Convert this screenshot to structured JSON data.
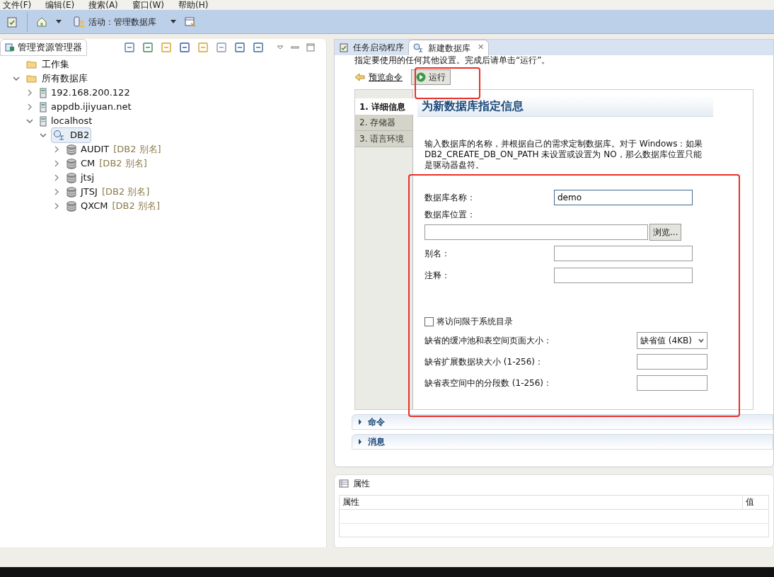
{
  "menu": [
    "文件(F)",
    "编辑(E)",
    "搜索(A)",
    "窗口(W)",
    "帮助(H)"
  ],
  "toolbar": {
    "activity": "活动：管理数据库"
  },
  "explorer": {
    "title": "管理资源管理器",
    "tree": [
      {
        "kind": "folder",
        "label": "工作集"
      },
      {
        "kind": "folder",
        "label": "所有数据库",
        "expanded": true,
        "children": [
          {
            "kind": "server",
            "label": "192.168.200.122",
            "expanded": false
          },
          {
            "kind": "server",
            "label": "appdb.ijiyuan.net",
            "expanded": false
          },
          {
            "kind": "server",
            "label": "localhost",
            "expanded": true,
            "children": [
              {
                "kind": "instance",
                "label": "DB2",
                "expanded": true,
                "selected": true,
                "children": [
                  {
                    "kind": "database",
                    "label": "AUDIT",
                    "suffix": "[DB2 别名]",
                    "expanded": false
                  },
                  {
                    "kind": "database",
                    "label": "CM",
                    "suffix": "[DB2 别名]",
                    "expanded": false
                  },
                  {
                    "kind": "database",
                    "label": "jtsj",
                    "expanded": false
                  },
                  {
                    "kind": "database",
                    "label": "JTSJ",
                    "suffix": "[DB2 别名]",
                    "expanded": false
                  },
                  {
                    "kind": "database",
                    "label": "QXCM",
                    "suffix": "[DB2 别名]",
                    "expanded": false
                  }
                ]
              }
            ]
          }
        ]
      }
    ]
  },
  "editor": {
    "tabs": [
      {
        "label": "任务启动程序",
        "selected": false
      },
      {
        "label": "新建数据库",
        "selected": true,
        "close": "✕"
      }
    ],
    "intro": "指定要使用的任何其他设置。完成后请单击“运行”。",
    "preview_link": "预览命令",
    "run_button": "运行",
    "steps": [
      {
        "label": "1. 详细信息",
        "selected": true
      },
      {
        "label": "2. 存储器",
        "selected": false
      },
      {
        "label": "3. 语言环境",
        "selected": false
      }
    ],
    "heading": "为新数据库指定信息",
    "description": "输入数据库的名称，并根据自己的需求定制数据库。对于 Windows：如果 DB2_CREATE_DB_ON_PATH 未设置或设置为 NO，那么数据库位置只能是驱动器盘符。",
    "fields": [
      {
        "kind": "text",
        "label": "数据库名称：",
        "value": "demo",
        "focused": true
      },
      {
        "kind": "path",
        "label": "数据库位置：",
        "button": "浏览..."
      },
      {
        "kind": "text",
        "label": "别名："
      },
      {
        "kind": "text",
        "label": "注释："
      },
      {
        "kind": "spacer"
      },
      {
        "kind": "checkbox",
        "label": "将访问限于系统目录",
        "checked": false
      },
      {
        "kind": "select",
        "label": "缺省的缓冲池和表空间页面大小：",
        "value": "缺省值 (4KB)"
      },
      {
        "kind": "small",
        "label": "缺省扩展数据块大小 (1-256)："
      },
      {
        "kind": "small",
        "label": "缺省表空间中的分段数 (1-256)："
      }
    ],
    "sections": [
      {
        "label": "命令",
        "expanded": false
      },
      {
        "label": "消息",
        "expanded": false
      }
    ]
  },
  "properties": {
    "title": "属性",
    "columns": [
      "属性",
      "值"
    ]
  }
}
